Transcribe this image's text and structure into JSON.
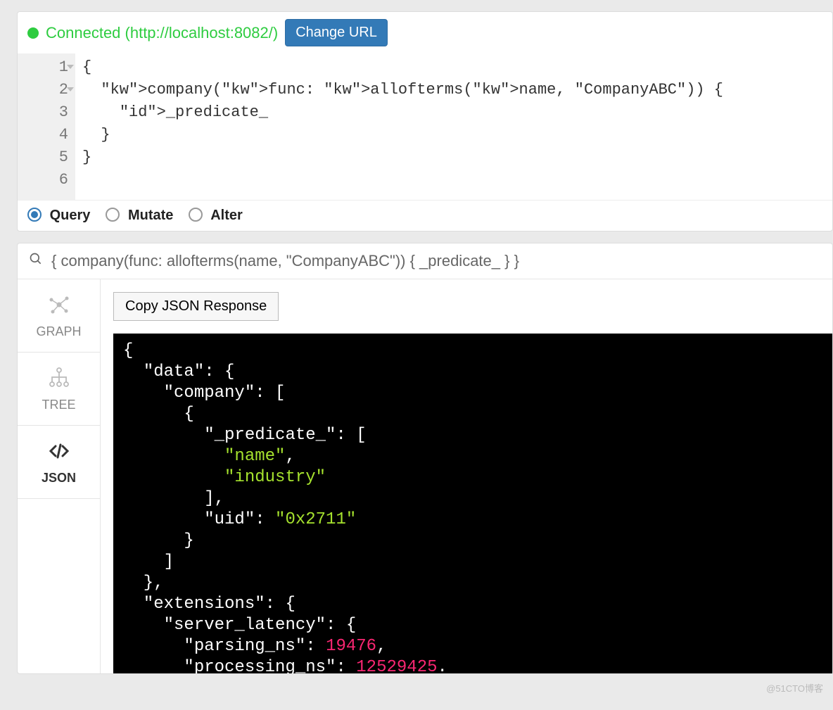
{
  "connection": {
    "status_text": "Connected (http://localhost:8082/)",
    "change_url_label": "Change URL",
    "dot_color": "#2ecc40"
  },
  "editor": {
    "lines": [
      "{",
      "  company(func: allofterms(name, \"CompanyABC\")) {",
      "    _predicate_",
      "  }",
      "}",
      ""
    ]
  },
  "modes": {
    "options": [
      "Query",
      "Mutate",
      "Alter"
    ],
    "selected": "Query"
  },
  "search": {
    "text": "{ company(func: allofterms(name, \"CompanyABC\")) { _predicate_ } }"
  },
  "side_tabs": {
    "items": [
      {
        "id": "graph",
        "label": "GRAPH"
      },
      {
        "id": "tree",
        "label": "TREE"
      },
      {
        "id": "json",
        "label": "JSON"
      }
    ],
    "active": "json"
  },
  "copy_label": "Copy JSON Response",
  "json_response": {
    "data": {
      "company": [
        {
          "_predicate_": [
            "name",
            "industry"
          ],
          "uid": "0x2711"
        }
      ]
    },
    "extensions": {
      "server_latency": {
        "parsing_ns": 19476,
        "processing_ns": 12529425
      }
    }
  },
  "watermark": "@51CTO博客"
}
